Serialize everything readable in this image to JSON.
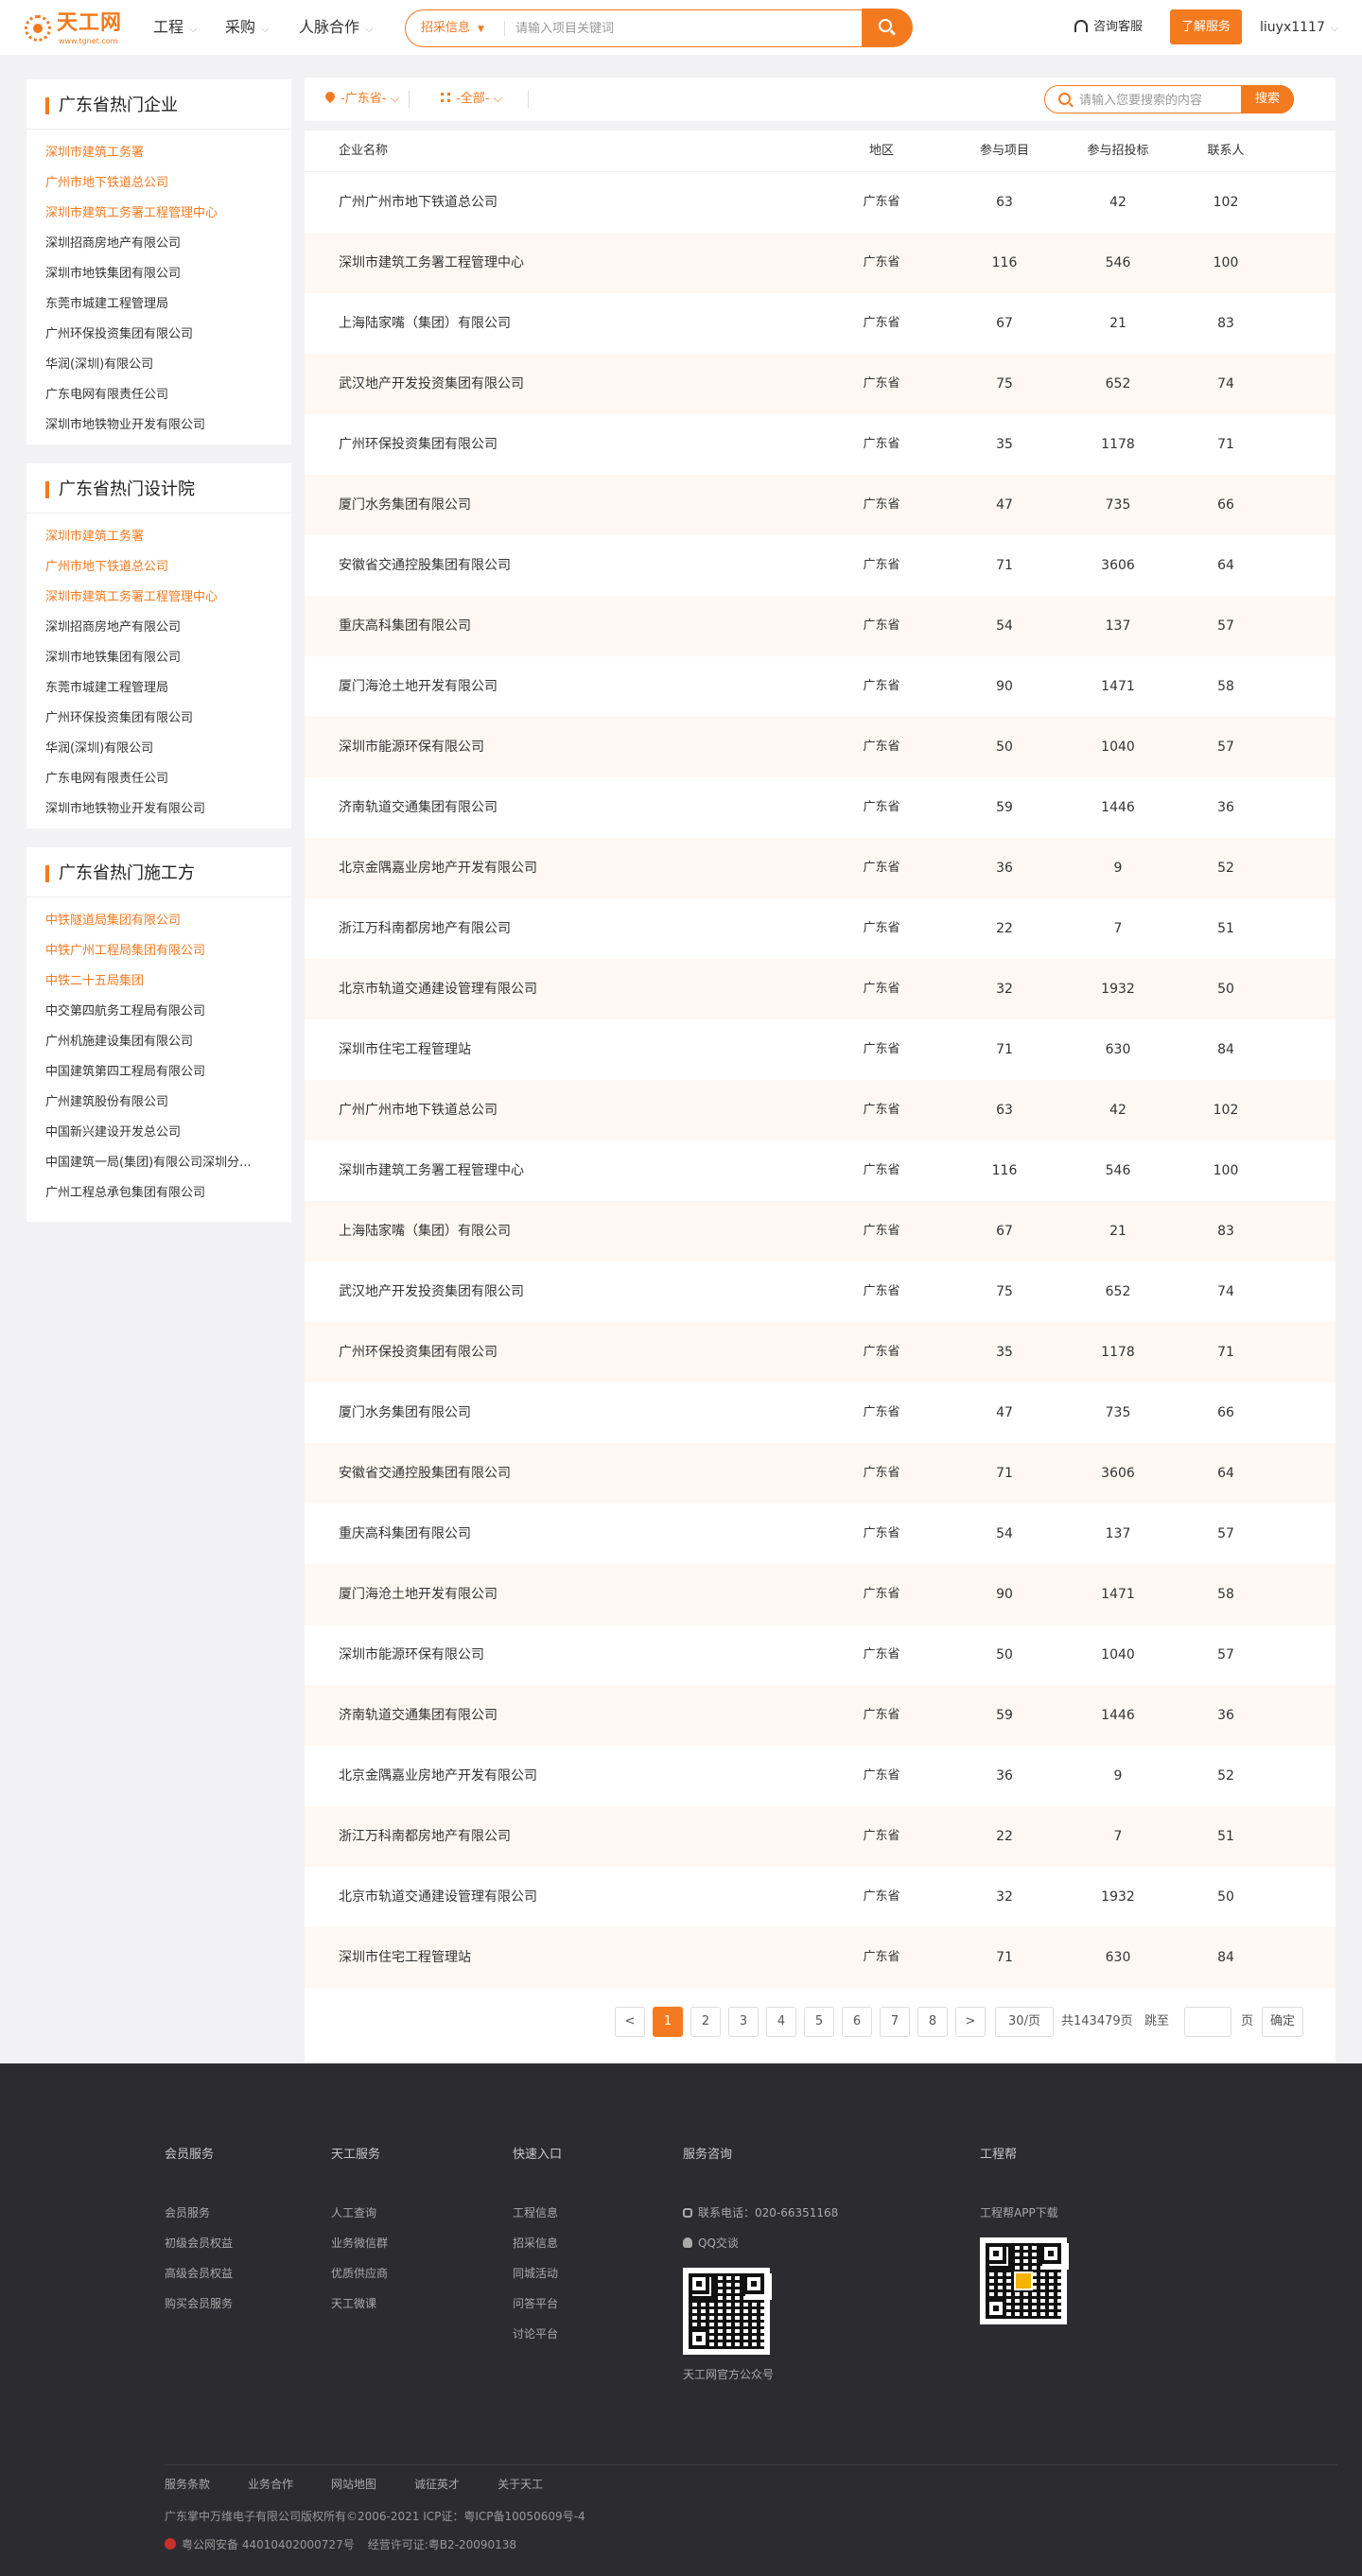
{
  "header": {
    "logo_brand": "天工网",
    "logo_url": "www.tgnet.com",
    "nav": [
      "工程",
      "采购",
      "人脉合作"
    ],
    "search_category": "招采信息",
    "search_placeholder": "请输入项目关键词",
    "consult": "咨询客服",
    "learn_btn": "了解服务",
    "username": "liuyx1117"
  },
  "sidebar": [
    {
      "title": "广东省热门企业",
      "hot_count": 3,
      "items": [
        "深圳市建筑工务署",
        "广州市地下铁道总公司",
        "深圳市建筑工务署工程管理中心",
        "深圳招商房地产有限公司",
        "深圳市地铁集团有限公司",
        "东莞市城建工程管理局",
        "广州环保投资集团有限公司",
        "华润(深圳)有限公司",
        "广东电网有限责任公司",
        "深圳市地铁物业开发有限公司"
      ]
    },
    {
      "title": "广东省热门设计院",
      "hot_count": 3,
      "items": [
        "深圳市建筑工务署",
        "广州市地下铁道总公司",
        "深圳市建筑工务署工程管理中心",
        "深圳招商房地产有限公司",
        "深圳市地铁集团有限公司",
        "东莞市城建工程管理局",
        "广州环保投资集团有限公司",
        "华润(深圳)有限公司",
        "广东电网有限责任公司",
        "深圳市地铁物业开发有限公司"
      ]
    },
    {
      "title": "广东省热门施工方",
      "hot_count": 3,
      "items": [
        "中铁隧道局集团有限公司",
        "中铁广州工程局集团有限公司",
        "中铁二十五局集团",
        "中交第四航务工程局有限公司",
        "广州机施建设集团有限公司",
        "中国建筑第四工程局有限公司",
        "广州建筑股份有限公司",
        "中国新兴建设开发总公司",
        "中国建筑一局(集团)有限公司深圳分...",
        "广州工程总承包集团有限公司"
      ]
    }
  ],
  "filters": {
    "region": "-广东省-",
    "category": "-全部-",
    "search_placeholder": "请输入您要搜索的内容",
    "search_btn": "搜索"
  },
  "table": {
    "headers": [
      "企业名称",
      "地区",
      "参与项目",
      "参与招投标",
      "联系人"
    ],
    "rows": [
      [
        "广州广州市地下铁道总公司",
        "广东省",
        "63",
        "42",
        "102"
      ],
      [
        "深圳市建筑工务署工程管理中心",
        "广东省",
        "116",
        "546",
        "100"
      ],
      [
        "上海陆家嘴（集团）有限公司",
        "广东省",
        "67",
        "21",
        "83"
      ],
      [
        "武汉地产开发投资集团有限公司",
        "广东省",
        "75",
        "652",
        "74"
      ],
      [
        "广州环保投资集团有限公司",
        "广东省",
        "35",
        "1178",
        "71"
      ],
      [
        "厦门水务集团有限公司",
        "广东省",
        "47",
        "735",
        "66"
      ],
      [
        "安徽省交通控股集团有限公司",
        "广东省",
        "71",
        "3606",
        "64"
      ],
      [
        "重庆高科集团有限公司",
        "广东省",
        "54",
        "137",
        "57"
      ],
      [
        "厦门海沧土地开发有限公司",
        "广东省",
        "90",
        "1471",
        "58"
      ],
      [
        "深圳市能源环保有限公司",
        "广东省",
        "50",
        "1040",
        "57"
      ],
      [
        "济南轨道交通集团有限公司",
        "广东省",
        "59",
        "1446",
        "36"
      ],
      [
        "北京金隅嘉业房地产开发有限公司",
        "广东省",
        "36",
        "9",
        "52"
      ],
      [
        "浙江万科南都房地产有限公司",
        "广东省",
        "22",
        "7",
        "51"
      ],
      [
        "北京市轨道交通建设管理有限公司",
        "广东省",
        "32",
        "1932",
        "50"
      ],
      [
        "深圳市住宅工程管理站",
        "广东省",
        "71",
        "630",
        "84"
      ],
      [
        "广州广州市地下铁道总公司",
        "广东省",
        "63",
        "42",
        "102"
      ],
      [
        "深圳市建筑工务署工程管理中心",
        "广东省",
        "116",
        "546",
        "100"
      ],
      [
        "上海陆家嘴（集团）有限公司",
        "广东省",
        "67",
        "21",
        "83"
      ],
      [
        "武汉地产开发投资集团有限公司",
        "广东省",
        "75",
        "652",
        "74"
      ],
      [
        "广州环保投资集团有限公司",
        "广东省",
        "35",
        "1178",
        "71"
      ],
      [
        "厦门水务集团有限公司",
        "广东省",
        "47",
        "735",
        "66"
      ],
      [
        "安徽省交通控股集团有限公司",
        "广东省",
        "71",
        "3606",
        "64"
      ],
      [
        "重庆高科集团有限公司",
        "广东省",
        "54",
        "137",
        "57"
      ],
      [
        "厦门海沧土地开发有限公司",
        "广东省",
        "90",
        "1471",
        "58"
      ],
      [
        "深圳市能源环保有限公司",
        "广东省",
        "50",
        "1040",
        "57"
      ],
      [
        "济南轨道交通集团有限公司",
        "广东省",
        "59",
        "1446",
        "36"
      ],
      [
        "北京金隅嘉业房地产开发有限公司",
        "广东省",
        "36",
        "9",
        "52"
      ],
      [
        "浙江万科南都房地产有限公司",
        "广东省",
        "22",
        "7",
        "51"
      ],
      [
        "北京市轨道交通建设管理有限公司",
        "广东省",
        "32",
        "1932",
        "50"
      ],
      [
        "深圳市住宅工程管理站",
        "广东省",
        "71",
        "630",
        "84"
      ]
    ]
  },
  "pagination": {
    "prev": "<",
    "pages": [
      "1",
      "2",
      "3",
      "4",
      "5",
      "6",
      "7",
      "8"
    ],
    "active_page": "1",
    "next": ">",
    "per_page": "30/页",
    "total": "共143479页",
    "goto_label": "跳至",
    "page_unit": "页",
    "confirm": "确定"
  },
  "footer": {
    "columns": [
      {
        "title": "会员服务",
        "links": [
          "会员服务",
          "初级会员权益",
          "高级会员权益",
          "购买会员服务"
        ]
      },
      {
        "title": "天工服务",
        "links": [
          "人工查询",
          "业务微信群",
          "优质供应商",
          "天工微课"
        ]
      },
      {
        "title": "快速入口",
        "links": [
          "工程信息",
          "招采信息",
          "同城活动",
          "问答平台",
          "讨论平台"
        ]
      }
    ],
    "consult_title": "服务咨询",
    "phone": "联系电话：020-66351168",
    "qq": "QQ交谈",
    "qr1_caption": "天工网官方公众号",
    "app_title": "工程帮",
    "app_download": "工程帮APP下载",
    "bottom_links": [
      "服务条款",
      "业务合作",
      "网站地图",
      "诚征英才",
      "关于天工"
    ],
    "copyright": "广东掌中万维电子有限公司版权所有©2006-2021 ICP证：粤ICP备10050609号-4",
    "beian": "粤公网安备 44010402000727号",
    "license": "经营许可证:粤B2-20090138"
  }
}
